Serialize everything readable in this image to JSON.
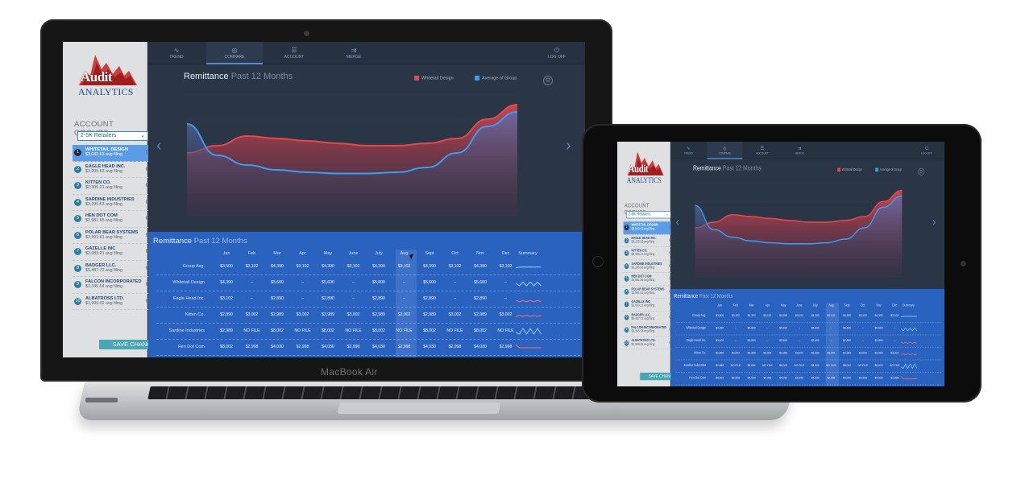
{
  "device_label": "MacBook Air",
  "app": {
    "logo": {
      "line1": "Audit",
      "line2": "ANALYTICS"
    },
    "nav_tabs": [
      {
        "label": "TREND",
        "icon": "trend-icon",
        "glyph": "∿"
      },
      {
        "label": "COMPARE",
        "icon": "compare-icon",
        "glyph": "◎"
      },
      {
        "label": "ACCOUNT",
        "icon": "account-list-icon",
        "glyph": "☰"
      },
      {
        "label": "MERGE",
        "icon": "merge-icon",
        "glyph": "⇉"
      },
      {
        "label": "LOG OFF",
        "icon": "power-icon",
        "glyph": "⏻"
      }
    ],
    "sidebar": {
      "groups_title": "ACCOUNT GROUPS",
      "group_selected": "2-5K Retailers",
      "accounts": [
        {
          "num": "1",
          "name": "WHITETAIL DESIGN",
          "sub": "$3,042.63 avg filing",
          "active": true
        },
        {
          "num": "2",
          "name": "EAGLE HEAD INC.",
          "sub": "$3,205.63 avg filing"
        },
        {
          "num": "3",
          "name": "KITTEN CO.",
          "sub": "$2,306.21 avg filing"
        },
        {
          "num": "4",
          "name": "SARDINE INDUSTRIES",
          "sub": "$3,295.63 avg filing"
        },
        {
          "num": "5",
          "name": "HEN DOT COM",
          "sub": "$2,981.65 avg filing"
        },
        {
          "num": "6",
          "name": "POLAR BEAR SYSTEMS",
          "sub": "$2,991.61 avg filing"
        },
        {
          "num": "7",
          "name": "GAZELLE INC",
          "sub": "$2,083.21 avg filing"
        },
        {
          "num": "8",
          "name": "BADGER LLC.",
          "sub": "$5,487.72 avg filing"
        },
        {
          "num": "9",
          "name": "FALCON INCORPORATED",
          "sub": "$2,345.54 avg filing"
        },
        {
          "num": "10",
          "name": "ALBATROSS LTD.",
          "sub": "$1,999.02 avg filing"
        }
      ],
      "save_label": "SAVE CHANGES"
    },
    "chart": {
      "title": "Remittance",
      "subtitle": "Past 12 Months",
      "legend": [
        {
          "name": "Whitetail Design",
          "color": "#e5484d"
        },
        {
          "name": "Average of Group",
          "color": "#3a9df0"
        }
      ]
    },
    "table": {
      "title": "Remittance",
      "subtitle": "Past 12 Months",
      "months": [
        "Jan",
        "Feb",
        "Mar",
        "Apr",
        "May",
        "June",
        "July",
        "Aug",
        "Sept",
        "Oct",
        "Nov",
        "Dec"
      ],
      "summary_label": "Summary",
      "rows": [
        {
          "label": "Group Avg.",
          "cells": [
            "$3,500",
            "$3,102",
            "$4,390",
            "$3,102",
            "$4,390",
            "$3,102",
            "$4,390",
            "$3,102",
            "$4,390",
            "$3,102",
            "$4,390",
            "$3,102"
          ],
          "spark_color": "#8fd3ff"
        },
        {
          "label": "Whitetail Design",
          "cells": [
            "$4,390",
            "–",
            "$5,600",
            "–",
            "$5,600",
            "–",
            "$5,600",
            "–",
            "$5,600",
            "–",
            "$5,600",
            "–"
          ],
          "spark_color": "#8fd3ff"
        },
        {
          "label": "Eagle Head Inc.",
          "cells": [
            "$3,102",
            "–",
            "$2,890",
            "–",
            "$2,890",
            "–",
            "$2,890",
            "–",
            "$2,890",
            "–",
            "$2,890",
            "–"
          ],
          "spark_color": "#ff6b7a"
        },
        {
          "label": "Kitten Co.",
          "cells": [
            "$2,890",
            "$3,002",
            "$2,989",
            "$3,002",
            "$2,989",
            "$3,002",
            "$2,989",
            "$3,002",
            "$2,989",
            "$3,002",
            "$2,989",
            "$3,002"
          ],
          "spark_color": "#ff6b7a"
        },
        {
          "label": "Sardine Industries",
          "cells": [
            "$2,989",
            "NO FILE",
            "$8,002",
            "NO FILE",
            "$8,002",
            "NO FILE",
            "$8,002",
            "NO FILE",
            "$8,002",
            "NO FILE",
            "$8,002",
            "NO FILE"
          ],
          "spark_color": "#8fd3ff"
        },
        {
          "label": "Hen Dot Com",
          "cells": [
            "$8,002",
            "$2,998",
            "$4,030",
            "$2,998",
            "$4,030",
            "$2,998",
            "$4,030",
            "$2,998",
            "$4,030",
            "$2,998",
            "$4,030",
            "$2,998"
          ],
          "spark_color": "#ff6b7a"
        }
      ]
    }
  },
  "chart_data": {
    "type": "area",
    "categories": [
      "Jan",
      "Feb",
      "Mar",
      "Apr",
      "May",
      "June",
      "July",
      "Aug",
      "Sept",
      "Oct",
      "Nov",
      "Dec"
    ],
    "series": [
      {
        "name": "Whitetail Design",
        "values": [
          52,
          58,
          66,
          64,
          62,
          60,
          58,
          58,
          60,
          64,
          80,
          92
        ]
      },
      {
        "name": "Average of Group",
        "values": [
          76,
          50,
          42,
          38,
          36,
          35,
          35,
          36,
          40,
          52,
          74,
          86
        ]
      }
    ],
    "ylim": [
      0,
      100
    ]
  }
}
